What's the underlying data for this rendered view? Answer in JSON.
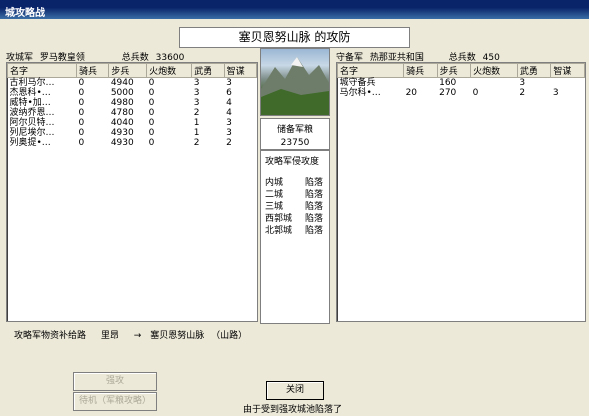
{
  "window": {
    "title": "城攻略战"
  },
  "battle_title": "塞贝恩努山脉 的攻防",
  "attacker": {
    "label": "攻城军",
    "commander": "罗马教皇领",
    "total_label": "总兵数",
    "total": "33600"
  },
  "defender": {
    "label": "守备军",
    "commander": "热那亚共和国",
    "total_label": "总兵数",
    "total": "450"
  },
  "columns": [
    "名字",
    "骑兵",
    "步兵",
    "火炮数",
    "武勇",
    "智谋"
  ],
  "attacker_rows": [
    [
      "古利马尔…",
      "0",
      "4940",
      "0",
      "3",
      "3"
    ],
    [
      "杰恩科•…",
      "0",
      "5000",
      "0",
      "3",
      "6"
    ],
    [
      "威特•加…",
      "0",
      "4980",
      "0",
      "3",
      "4"
    ],
    [
      "波纳乔恩…",
      "0",
      "4780",
      "0",
      "2",
      "4"
    ],
    [
      "阿尔贝特…",
      "0",
      "4040",
      "0",
      "1",
      "3"
    ],
    [
      "列尼埃尔…",
      "0",
      "4930",
      "0",
      "1",
      "3"
    ],
    [
      "列奥提•…",
      "0",
      "4930",
      "0",
      "2",
      "2"
    ]
  ],
  "defender_rows": [
    [
      "城守备兵",
      "",
      "160",
      "",
      "3",
      ""
    ],
    [
      "马尔科•…",
      "20",
      "270",
      "0",
      "2",
      "3"
    ]
  ],
  "reserve": {
    "label": "储备军粮",
    "value": "23750"
  },
  "progress": {
    "label": "攻略军侵攻度",
    "rows": [
      [
        "内城",
        "陷落"
      ],
      [
        "二城",
        "陷落"
      ],
      [
        "三城",
        "陷落"
      ],
      [
        "西郭城",
        "陷落"
      ],
      [
        "北郭城",
        "陷落"
      ]
    ]
  },
  "supply": {
    "label": "攻略军物资补给路",
    "from": "里昂",
    "arrow": "→",
    "to": "塞贝恩努山脉",
    "type": "（山路）"
  },
  "buttons": {
    "assault": "强攻",
    "wait": "待机（军粮攻略）",
    "close": "关闭"
  },
  "status_text": "由于受到强攻城池陷落了"
}
